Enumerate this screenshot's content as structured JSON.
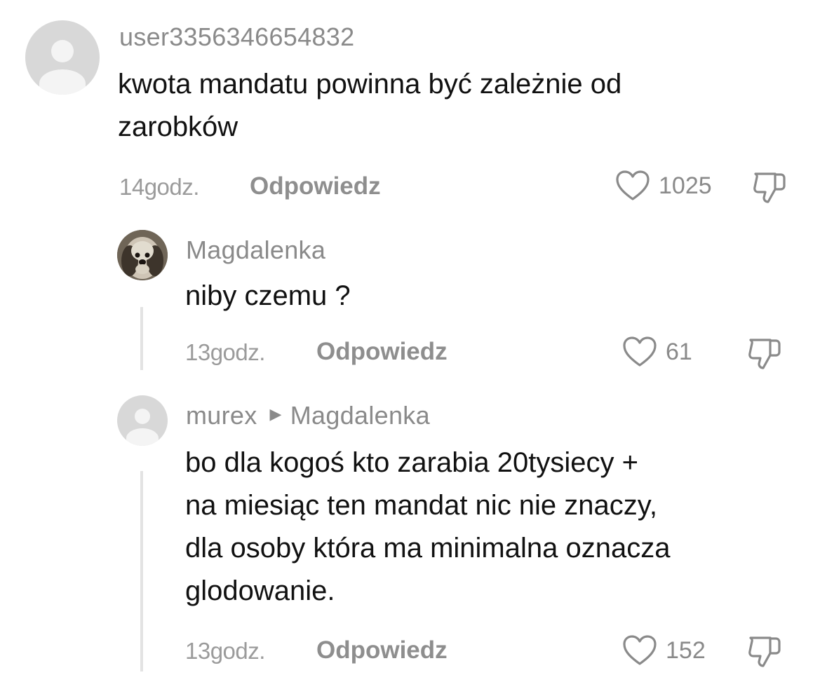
{
  "comments": [
    {
      "username": "user3356346654832",
      "lines": [
        "kwota mandatu powinna być zależnie od",
        "zarobków"
      ],
      "time": "14godz.",
      "reply": "Odpowiedz",
      "likes": "1025"
    },
    {
      "username": "Magdalenka",
      "lines": [
        "niby czemu ?"
      ],
      "time": "13godz.",
      "reply": "Odpowiedz",
      "likes": "61"
    },
    {
      "username": "murex",
      "reply_to": "Magdalenka",
      "lines": [
        "bo dla kogoś kto zarabia 20tysiecy +",
        "na miesiąc ten mandat nic nie znaczy,",
        "dla osoby która ma minimalna oznacza",
        "glodowanie."
      ],
      "time": "13godz.",
      "reply": "Odpowiedz",
      "likes": "152"
    }
  ],
  "icons": {
    "like": "heart-outline-icon",
    "dislike": "thumbs-down-outline-icon",
    "reply_arrow": "triangle-right-icon"
  },
  "colors": {
    "text": "#111111",
    "muted": "#8a8a8a",
    "thread_line": "#e3e3e3",
    "avatar_bg": "#d8d8d8"
  }
}
